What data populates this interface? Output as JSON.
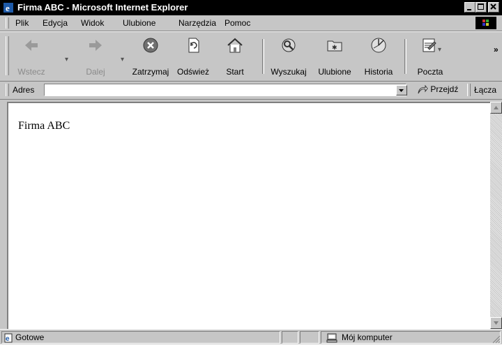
{
  "window": {
    "title": "Firma ABC - Microsoft Internet Explorer"
  },
  "menu": [
    {
      "label": "Plik"
    },
    {
      "label": "Edycja"
    },
    {
      "label": "Widok"
    },
    {
      "label": "Ulubione"
    },
    {
      "label": "Narzędzia"
    },
    {
      "label": "Pomoc"
    }
  ],
  "toolbar": {
    "back": {
      "label": "Wstecz",
      "icon": "back-arrow-icon",
      "enabled": false
    },
    "forward": {
      "label": "Dalej",
      "icon": "forward-arrow-icon",
      "enabled": false
    },
    "stop": {
      "label": "Zatrzymaj",
      "icon": "stop-icon"
    },
    "refresh": {
      "label": "Odśwież",
      "icon": "refresh-icon"
    },
    "home": {
      "label": "Start",
      "icon": "home-icon"
    },
    "search": {
      "label": "Wyszukaj",
      "icon": "search-icon"
    },
    "favorites": {
      "label": "Ulubione",
      "icon": "favorites-icon"
    },
    "history": {
      "label": "Historia",
      "icon": "history-icon"
    },
    "mail": {
      "label": "Poczta",
      "icon": "mail-icon"
    },
    "more": "»"
  },
  "address": {
    "label": "Adres",
    "value": "",
    "go_label": "Przejdź",
    "links_label": "Łącza"
  },
  "page": {
    "text": "Firma ABC"
  },
  "status": {
    "text": "Gotowe",
    "zone": "Mój komputer"
  }
}
